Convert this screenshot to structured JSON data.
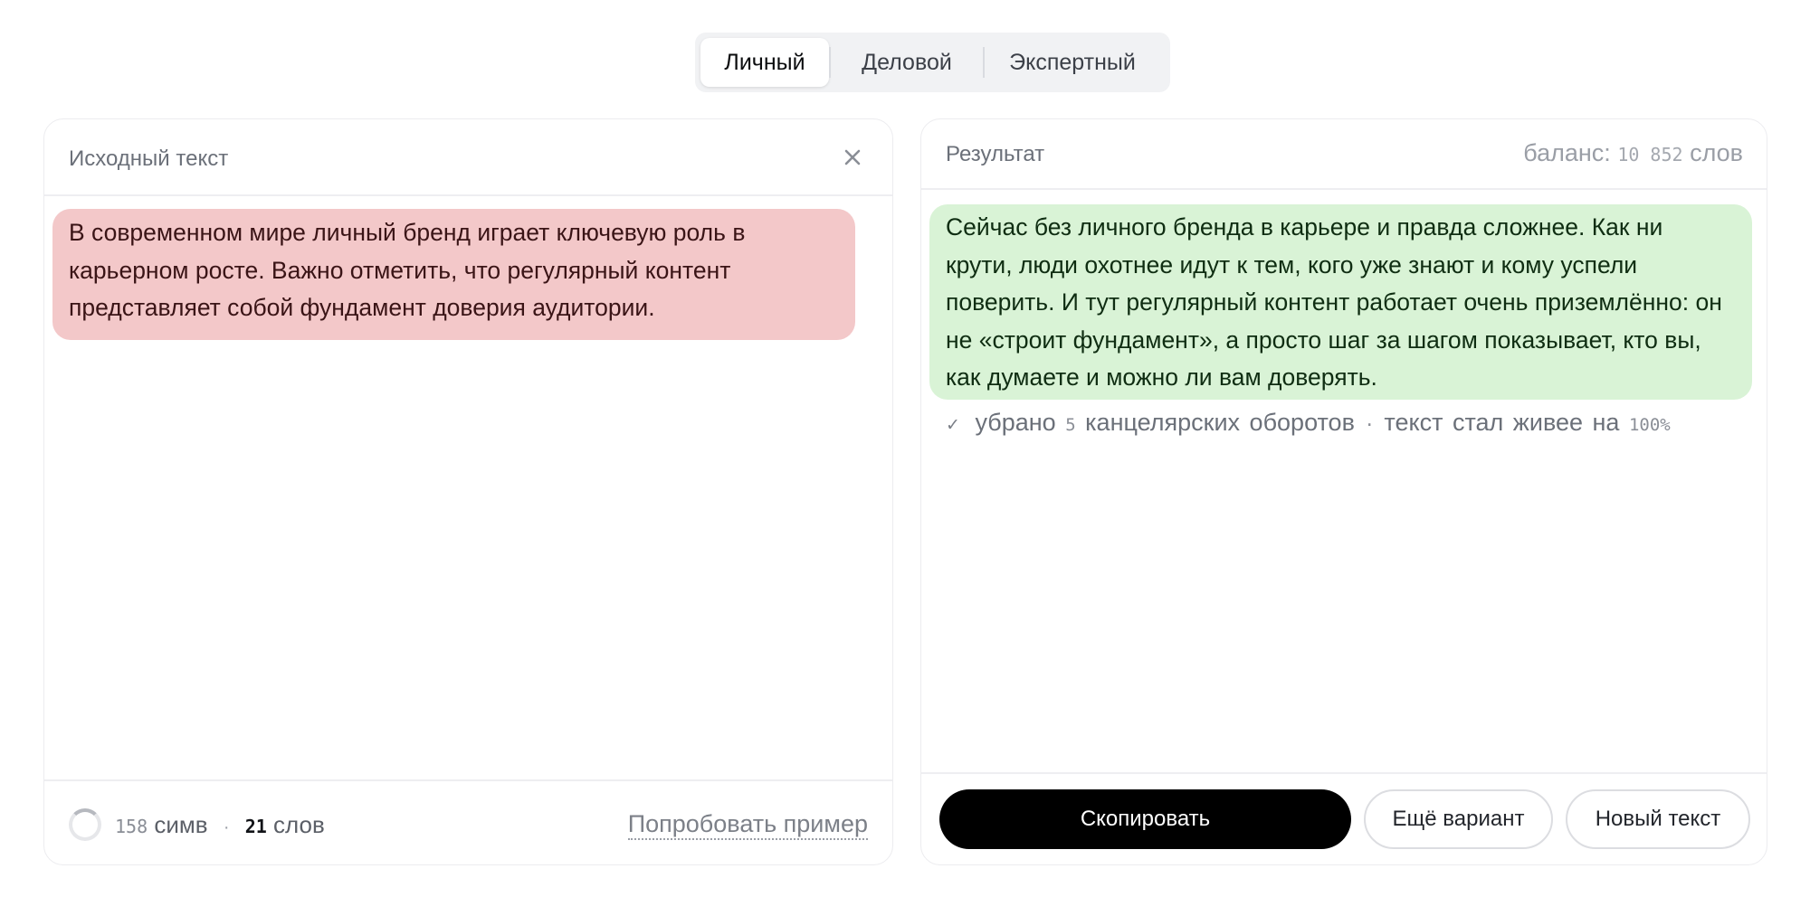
{
  "tabs": [
    {
      "label": "Личный",
      "active": true
    },
    {
      "label": "Деловой",
      "active": false
    },
    {
      "label": "Экспертный",
      "active": false
    }
  ],
  "source_panel": {
    "title": "Исходный текст",
    "text": "В современном мире личный бренд играет ключевую роль в карьерном росте. Важно отметить, что регулярный контент представляет собой фундамент доверия аудитории.",
    "char_count": "158",
    "char_unit": "симв",
    "separator": "·",
    "word_count": "21",
    "word_unit": "слов",
    "try_example": "Попробовать пример",
    "close_icon": "close-icon"
  },
  "result_panel": {
    "title": "Результат",
    "balance_label": "баланс:",
    "balance_value": "10 852",
    "balance_unit": "слов",
    "text": "Сейчас без личного бренда в карьере и правда сложнее. Как ни крути, люди охотнее идут к тем, кого уже знают и кому успели поверить. И тут регулярный контент работает очень приземлённо: он не «строит фундамент», а просто шаг за шагом показывает, кто вы, как думаете и можно ли вам доверять.",
    "stats": {
      "check": "✓",
      "removed_prefix": "убрано",
      "removed_count": "5",
      "removed_suffix": "канцелярских оборотов",
      "separator": "·",
      "livelier_prefix": "текст стал живее на",
      "livelier_value": "100%"
    },
    "buttons": {
      "copy": "Скопировать",
      "another_variant": "Ещё вариант",
      "new_text": "Новый текст"
    }
  },
  "colors": {
    "source_highlight": "#f3c8c9",
    "result_highlight": "#d9f3d6",
    "primary_button": "#000000"
  }
}
